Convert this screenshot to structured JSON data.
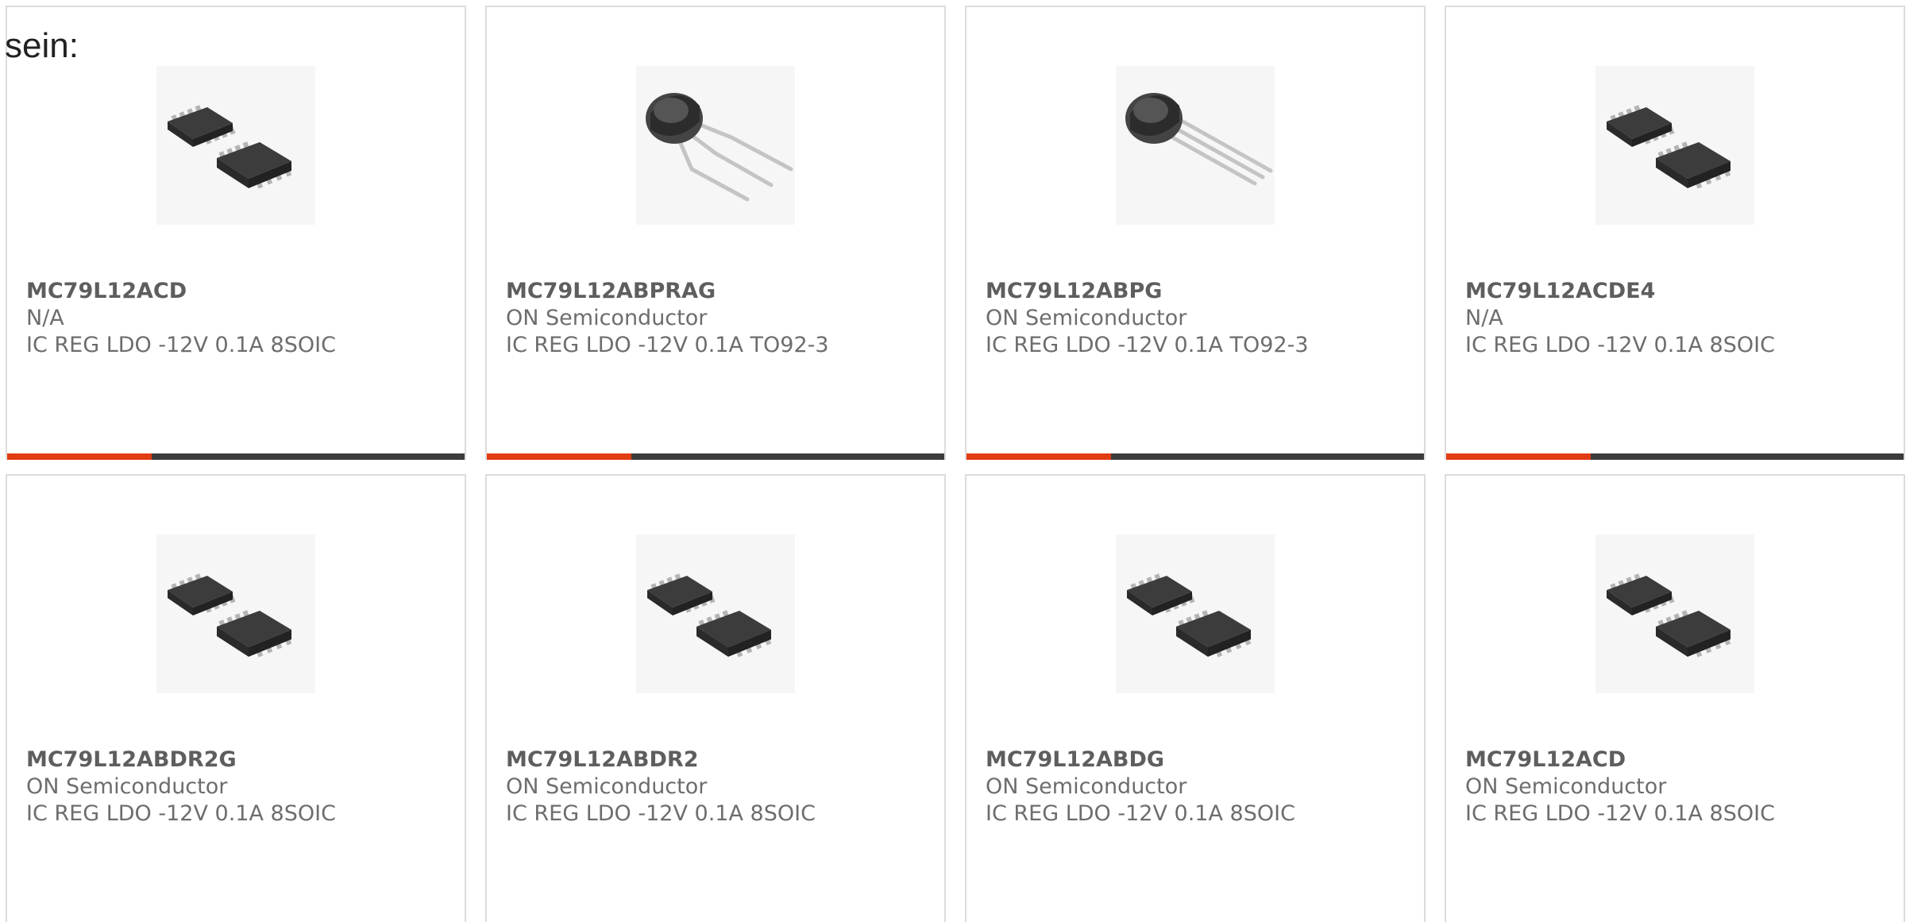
{
  "intro_text": "sein:",
  "colors": {
    "accent": "#e23c13",
    "bar": "#3c3c3c",
    "card_border": "#dcdcdc",
    "text": "#6d6d6d"
  },
  "products": [
    {
      "part_number": "MC79L12ACD",
      "manufacturer": "N/A",
      "description": "IC REG LDO -12V 0.1A 8SOIC",
      "package_icon": "soic8-chip-icon"
    },
    {
      "part_number": "MC79L12ABPRAG",
      "manufacturer": "ON Semiconductor",
      "description": "IC REG LDO -12V 0.1A TO92-3",
      "package_icon": "to92-bent-leads-icon"
    },
    {
      "part_number": "MC79L12ABPG",
      "manufacturer": "ON Semiconductor",
      "description": "IC REG LDO -12V 0.1A TO92-3",
      "package_icon": "to92-transistor-icon"
    },
    {
      "part_number": "MC79L12ACDE4",
      "manufacturer": "N/A",
      "description": "IC REG LDO -12V 0.1A 8SOIC",
      "package_icon": "soic8-chip-icon"
    },
    {
      "part_number": "MC79L12ABDR2G",
      "manufacturer": "ON Semiconductor",
      "description": "IC REG LDO -12V 0.1A 8SOIC",
      "package_icon": "soic8-chip-icon"
    },
    {
      "part_number": "MC79L12ABDR2",
      "manufacturer": "ON Semiconductor",
      "description": "IC REG LDO -12V 0.1A 8SOIC",
      "package_icon": "soic8-chip-icon"
    },
    {
      "part_number": "MC79L12ABDG",
      "manufacturer": "ON Semiconductor",
      "description": "IC REG LDO -12V 0.1A 8SOIC",
      "package_icon": "soic8-chip-icon"
    },
    {
      "part_number": "MC79L12ACD",
      "manufacturer": "ON Semiconductor",
      "description": "IC REG LDO -12V 0.1A 8SOIC",
      "package_icon": "soic8-chip-icon"
    }
  ]
}
